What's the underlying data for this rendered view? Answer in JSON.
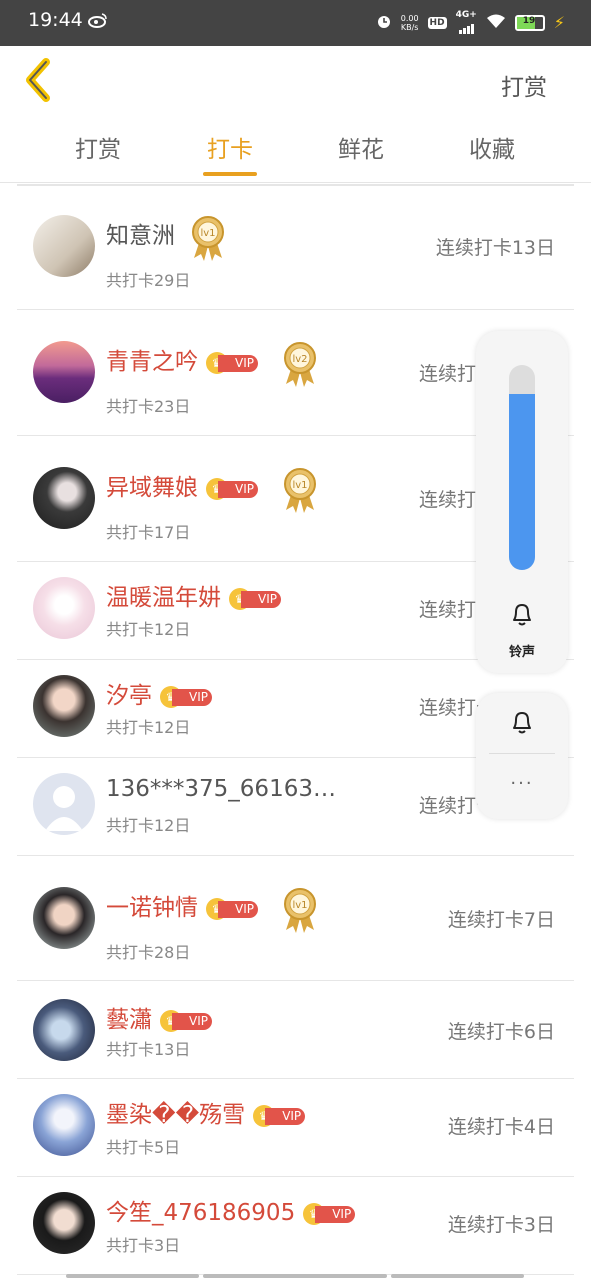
{
  "status_bar": {
    "time": "19:44",
    "net_speed_value": "0.00",
    "net_speed_unit": "KB/s",
    "hd": "HD",
    "network": "4G+",
    "battery": "19"
  },
  "header": {
    "title": "打赏"
  },
  "tabs": [
    {
      "label": "打赏",
      "active": false
    },
    {
      "label": "打卡",
      "active": true
    },
    {
      "label": "鲜花",
      "active": false
    },
    {
      "label": "收藏",
      "active": false
    }
  ],
  "entries": [
    {
      "name": "知意洲",
      "vip": false,
      "level": "lv1",
      "total": "共打卡29日",
      "streak": "连续打卡13日"
    },
    {
      "name": "青青之吟",
      "vip": true,
      "level": "lv2",
      "total": "共打卡23日",
      "streak": "连续打卡"
    },
    {
      "name": "异域舞娘",
      "vip": true,
      "level": "lv1",
      "total": "共打卡17日",
      "streak": "连续打卡"
    },
    {
      "name": "温暖温年妌",
      "vip": true,
      "level": "",
      "total": "共打卡12日",
      "streak": "连续打卡"
    },
    {
      "name": "汐亭",
      "vip": true,
      "level": "",
      "total": "共打卡12日",
      "streak": "连续打卡"
    },
    {
      "name": "136***375_66163…",
      "vip": false,
      "level": "",
      "total": "共打卡12日",
      "streak": "连续打卡"
    },
    {
      "name": "一诺钟情",
      "vip": true,
      "level": "lv1",
      "total": "共打卡28日",
      "streak": "连续打卡7日"
    },
    {
      "name": "藝瀟",
      "vip": true,
      "level": "",
      "total": "共打卡13日",
      "streak": "连续打卡6日"
    },
    {
      "name": "墨染��殇雪",
      "vip": true,
      "level": "",
      "total": "共打卡5日",
      "streak": "连续打卡4日"
    },
    {
      "name": "今笙_476186905",
      "vip": true,
      "level": "",
      "total": "共打卡3日",
      "streak": "连续打卡3日"
    }
  ],
  "vip_label": "VIP",
  "volume_panel": {
    "level": 0.86,
    "label": "铃声"
  },
  "more_label": "···",
  "colors": {
    "accent": "#e8a020",
    "vip_name": "#d44a3a",
    "volume": "#4c96ef"
  }
}
